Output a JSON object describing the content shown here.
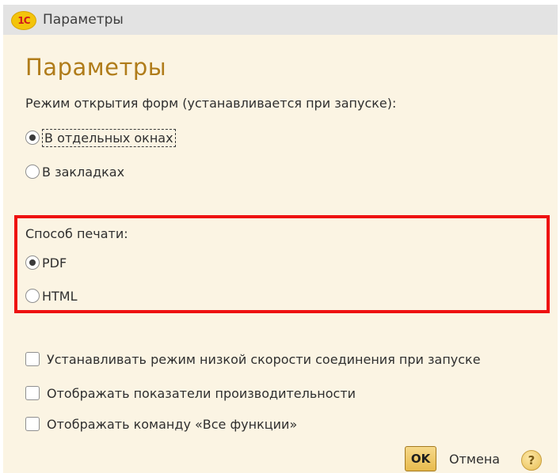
{
  "window": {
    "title": "Параметры",
    "logo_text": "1С"
  },
  "page_title": "Параметры",
  "form_mode": {
    "label": "Режим открытия форм (устанавливается при запуске):",
    "options": [
      {
        "label": "В отдельных окнах",
        "checked": true
      },
      {
        "label": "В закладках",
        "checked": false
      }
    ]
  },
  "print_mode": {
    "label": "Способ печати:",
    "options": [
      {
        "label": "PDF",
        "checked": true
      },
      {
        "label": "HTML",
        "checked": false
      }
    ],
    "highlight_color": "#ee1111"
  },
  "checkboxes": [
    {
      "label": "Устанавливать режим низкой скорости соединения при запуске",
      "checked": false
    },
    {
      "label": "Отображать показатели производительности",
      "checked": false
    },
    {
      "label": "Отображать команду «Все функции»",
      "checked": false
    }
  ],
  "buttons": {
    "ok_label": "OK",
    "cancel_label": "Отмена",
    "help_icon": "question-icon",
    "help_glyph": "?"
  },
  "colors": {
    "background": "#fbf4e3",
    "title_accent": "#b07c1a"
  }
}
